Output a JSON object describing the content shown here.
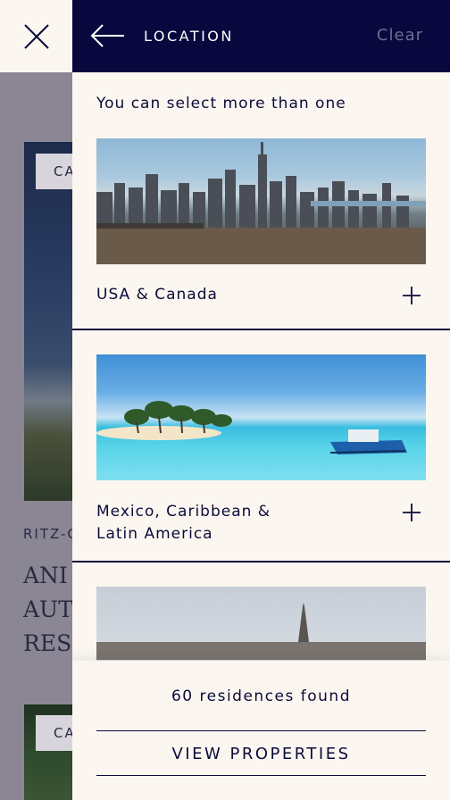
{
  "header": {
    "title": "LOCATION",
    "clear_label": "Clear",
    "back_icon": "arrow-left-icon",
    "close_icon": "close-icon"
  },
  "hint": "You can select more than one",
  "regions": [
    {
      "label": "USA & Canada",
      "image": "new-york-skyline"
    },
    {
      "label_line1": "Mexico, Caribbean &",
      "label_line2": "Latin America",
      "image": "caribbean-island"
    },
    {
      "image": "paris-skyline"
    }
  ],
  "footer": {
    "found_text": "60 residences found",
    "view_label": "VIEW PROPERTIES"
  },
  "background": {
    "tag": "CA",
    "ritz": "RITZ-C",
    "title_line1": "ANI",
    "title_line2": "AUT",
    "title_line3": "RES"
  },
  "colors": {
    "navy": "#08083f",
    "cream": "#fbf7f0",
    "text": "#0b0b3b"
  }
}
